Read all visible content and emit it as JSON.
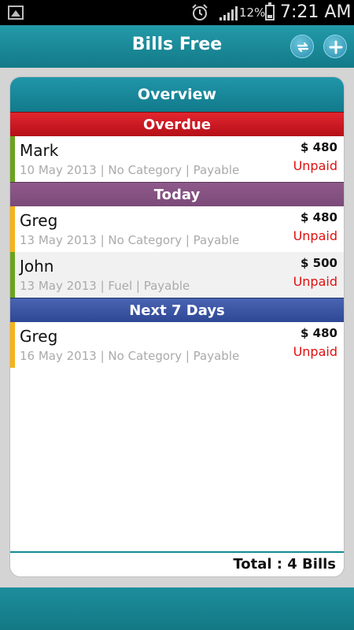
{
  "status_bar": {
    "battery_percent": "12%",
    "time": "7:21 AM",
    "icons": [
      "image-notification-icon",
      "alarm-clock-icon",
      "signal-icon",
      "battery-icon"
    ]
  },
  "app_bar": {
    "title": "Bills Free",
    "sync_icon": "sync-icon",
    "add_icon": "add-icon"
  },
  "overview": {
    "title": "Overview",
    "sections": [
      {
        "label": "Overdue",
        "color": "#c8161f",
        "bills": [
          {
            "name": "Mark",
            "meta": "10 May 2013 | No Category | Payable",
            "amount": "$ 480",
            "status": "Unpaid",
            "indicator": "#6aa41f"
          }
        ]
      },
      {
        "label": "Today",
        "color": "#865283",
        "bills": [
          {
            "name": "Greg",
            "meta": "13 May 2013 | No Category | Payable",
            "amount": "$ 480",
            "status": "Unpaid",
            "indicator": "#f5b31b"
          },
          {
            "name": "John",
            "meta": "13 May 2013 | Fuel | Payable",
            "amount": "$ 500",
            "status": "Unpaid",
            "indicator": "#6aa41f"
          }
        ]
      },
      {
        "label": "Next 7 Days",
        "color": "#3b56a6",
        "bills": [
          {
            "name": "Greg",
            "meta": "16 May 2013 | No Category | Payable",
            "amount": "$ 480",
            "status": "Unpaid",
            "indicator": "#f5b31b"
          }
        ]
      }
    ],
    "total": "Total : 4 Bills"
  },
  "colors": {
    "accent": "#178a98",
    "unpaid": "#e01010"
  }
}
